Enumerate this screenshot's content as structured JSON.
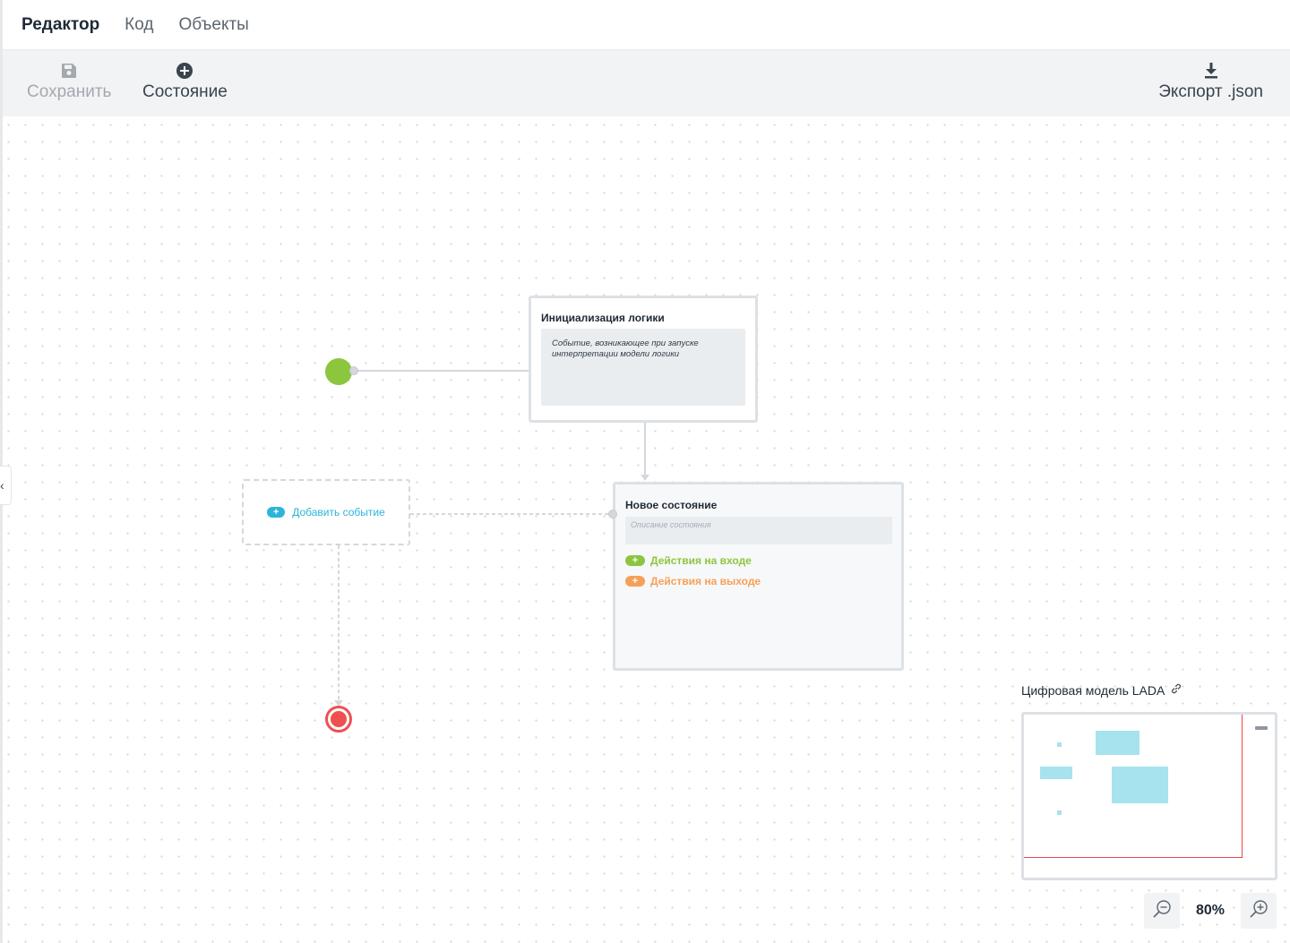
{
  "nav": {
    "tabs": [
      {
        "label": "Редактор",
        "active": true
      },
      {
        "label": "Код",
        "active": false
      },
      {
        "label": "Объекты",
        "active": false
      }
    ]
  },
  "toolbar": {
    "save": {
      "label": "Сохранить",
      "icon": "save-icon",
      "disabled": true
    },
    "add_state": {
      "label": "Состояние",
      "icon": "plus-circle-icon"
    },
    "export": {
      "label": "Экспорт .json",
      "icon": "download-icon"
    }
  },
  "diagram": {
    "init_node": {
      "title": "Инициализация логики",
      "description": "Событие, возникающее при запуске интерпретации модели логики"
    },
    "state_node": {
      "title": "Новое состояние",
      "description_placeholder": "Описание состояния",
      "actions_enter": "Действия на входе",
      "actions_exit": "Действия на выходе"
    },
    "event_node": {
      "label": "Добавить событие"
    }
  },
  "minimap": {
    "title": "Цифровая модель LADA",
    "icon": "link-icon"
  },
  "zoom": {
    "level": "80%"
  },
  "colors": {
    "start": "#8cc63f",
    "end": "#ee5050",
    "event": "#2bb5d9",
    "enter": "#8cc63f",
    "exit": "#f5a05a",
    "minimap_shape": "#a6e3ee"
  }
}
